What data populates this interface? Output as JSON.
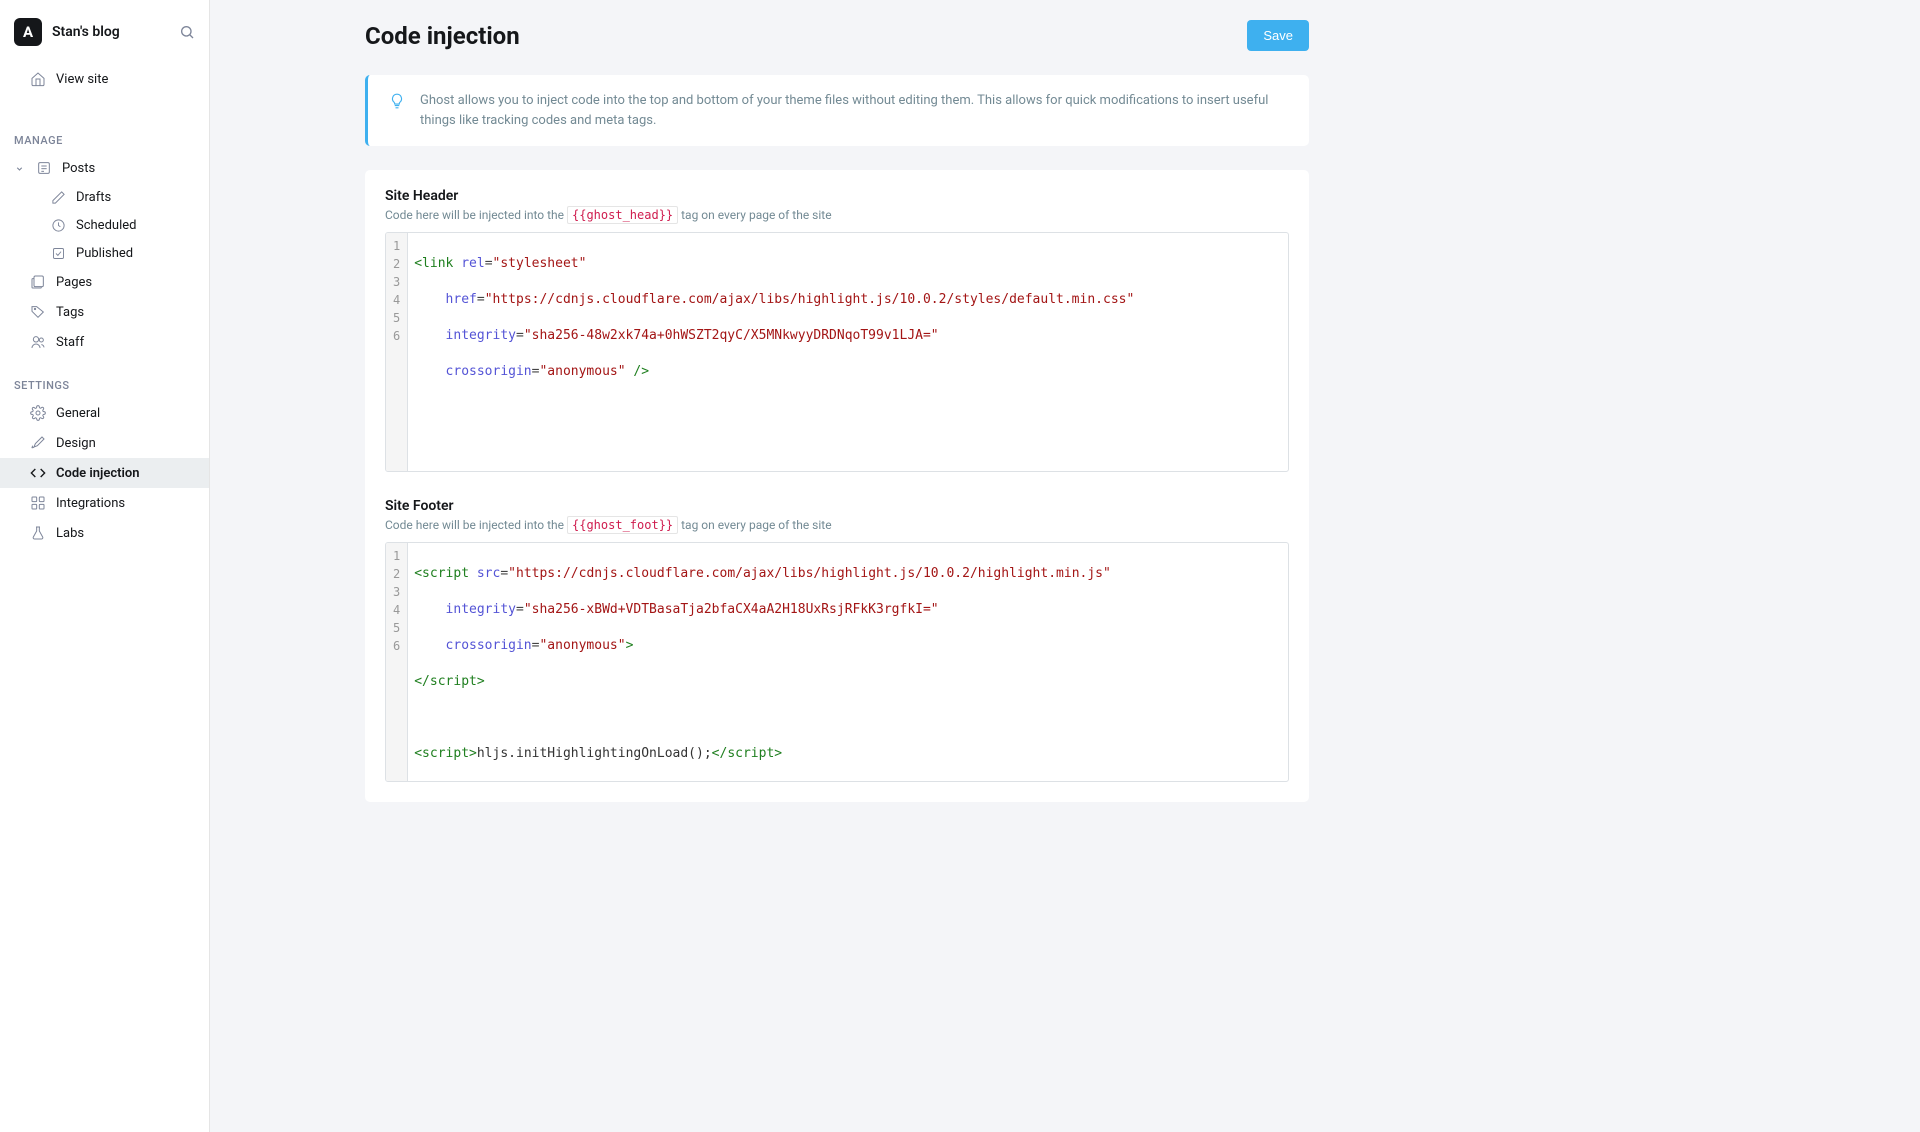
{
  "site": {
    "logo_letter": "A",
    "title": "Stan's blog"
  },
  "sidebar": {
    "view_site": "View site",
    "sections": {
      "manage": {
        "title": "MANAGE",
        "posts": "Posts",
        "drafts": "Drafts",
        "scheduled": "Scheduled",
        "published": "Published",
        "pages": "Pages",
        "tags": "Tags",
        "staff": "Staff"
      },
      "settings": {
        "title": "SETTINGS",
        "general": "General",
        "design": "Design",
        "code_injection": "Code injection",
        "integrations": "Integrations",
        "labs": "Labs"
      }
    }
  },
  "page": {
    "title": "Code injection",
    "save": "Save",
    "info": "Ghost allows you to inject code into the top and bottom of your theme files without editing them. This allows for quick modifications to insert useful things like tracking codes and meta tags."
  },
  "header_section": {
    "title": "Site Header",
    "desc_before": "Code here will be injected into the ",
    "desc_tag": "{{ghost_head}}",
    "desc_after": " tag on every page of the site",
    "line_numbers": [
      "1",
      "2",
      "3",
      "4",
      "5",
      "6"
    ],
    "code": {
      "l1_tag": "<link",
      "l1_attr": " rel",
      "l1_eq": "=",
      "l1_str": "\"stylesheet\"",
      "l2_attr": "    href",
      "l2_eq": "=",
      "l2_str": "\"https://cdnjs.cloudflare.com/ajax/libs/highlight.js/10.0.2/styles/default.min.css\"",
      "l3_attr": "    integrity",
      "l3_eq": "=",
      "l3_str": "\"sha256-48w2xk74a+0hWSZT2qyC/X5MNkwyyDRDNqoT99v1LJA=\"",
      "l4_attr": "    crossorigin",
      "l4_eq": "=",
      "l4_str": "\"anonymous\"",
      "l4_close": " />"
    }
  },
  "footer_section": {
    "title": "Site Footer",
    "desc_before": "Code here will be injected into the ",
    "desc_tag": "{{ghost_foot}}",
    "desc_after": " tag on every page of the site",
    "line_numbers": [
      "1",
      "2",
      "3",
      "4",
      "5",
      "6"
    ],
    "code": {
      "l1_tag": "<script",
      "l1_attr": " src",
      "l1_eq": "=",
      "l1_str": "\"https://cdnjs.cloudflare.com/ajax/libs/highlight.js/10.0.2/highlight.min.js\"",
      "l2_attr": "    integrity",
      "l2_eq": "=",
      "l2_str": "\"sha256-xBWd+VDTBasaTja2bfaCX4aA2H18UxRsjRFkK3rgfkI=\"",
      "l3_attr": "    crossorigin",
      "l3_eq": "=",
      "l3_str": "\"anonymous\"",
      "l3_close": ">",
      "l4_tag": "</script>",
      "l6_open": "<script>",
      "l6_body": "hljs.initHighlightingOnLoad();",
      "l6_close": "</script>"
    }
  }
}
